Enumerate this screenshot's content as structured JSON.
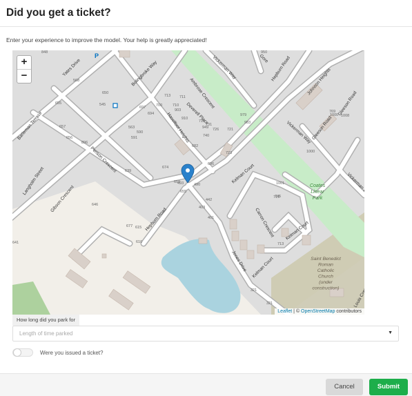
{
  "header": {
    "title": "Did you get a ticket?"
  },
  "intro": "Enter your experience to improve the model. Your help is greatly appreciated!",
  "map": {
    "zoom_in": "+",
    "zoom_out": "−",
    "attribution": {
      "leaflet": "Leaflet",
      "sep": " | © ",
      "osm": "OpenStreetMap",
      "suffix": " contributors"
    },
    "street_labels": [
      "Yates Drive",
      "Bolingbroke Way",
      "Vickerman Way",
      "Gore",
      "Hepburn Road",
      "Johnson Heights",
      "Gleeson Road",
      "Ambrose Crescent",
      "Deverell Place",
      "Haselfoot Heights",
      "Barleman Terrace",
      "Penson Crescent",
      "Langholm Street",
      "Gibson Crescent",
      "Hepburn Road",
      "Kelman Court",
      "Carron Crescent",
      "Kelman Court",
      "Kelman Court",
      "Jones Drive",
      "Louis Crescent",
      "Vickerman Way",
      "Gleeson Road",
      "Vickerman Way"
    ],
    "area_labels": [
      "Coates Linear Park",
      "Saint Benedict Roman Catholic Church (under construction)"
    ],
    "house_numbers": [
      "568",
      "650",
      "655",
      "657",
      "656",
      "545",
      "563",
      "590",
      "591",
      "697",
      "694",
      "700",
      "713",
      "710",
      "711",
      "903",
      "910",
      "949",
      "731",
      "740",
      "979",
      "983",
      "726",
      "715",
      "721",
      "682",
      "723",
      "696",
      "639",
      "674",
      "659",
      "655",
      "493",
      "490",
      "442",
      "403",
      "401",
      "646",
      "677",
      "615",
      "610",
      "641",
      "896",
      "1001",
      "745",
      "719",
      "1000",
      "769",
      "713",
      "321",
      "321",
      "848",
      "950",
      "987",
      "1000",
      "1008"
    ]
  },
  "form": {
    "duration_label": "How long did you park for",
    "duration_placeholder": "Length of time parked",
    "ticket_label": "Were you issued a ticket?"
  },
  "buttons": {
    "cancel": "Cancel",
    "submit": "Submit"
  },
  "colors": {
    "submit": "#1dae4b",
    "cancel": "#d9d9d9",
    "park": "#c8ecc8",
    "water": "#aad3df",
    "pin": "#2a81cb"
  },
  "icons": [
    "parking-icon",
    "map-marker-icon",
    "bus-stop-icon",
    "dropdown-caret-icon"
  ]
}
